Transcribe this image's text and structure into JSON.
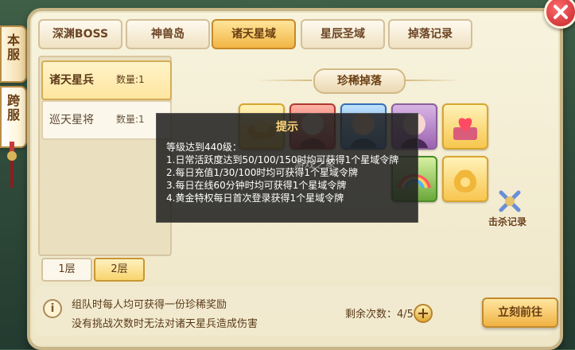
{
  "side_tabs": {
    "local": "本服",
    "cross": "跨服"
  },
  "top_tabs": [
    {
      "label": "深渊BOSS",
      "active": false
    },
    {
      "label": "神兽岛",
      "active": false
    },
    {
      "label": "诸天星域",
      "active": true
    },
    {
      "label": "星辰圣域",
      "active": false
    },
    {
      "label": "掉落记录",
      "active": false
    }
  ],
  "boss_list": [
    {
      "name": "诸天星兵",
      "quantity": "数量:1",
      "active": true
    },
    {
      "name": "巡天星将",
      "quantity": "数量:1",
      "active": false
    }
  ],
  "floors": [
    {
      "label": "1层",
      "active": false
    },
    {
      "label": "2层",
      "active": true
    }
  ],
  "rare_drops": {
    "title": "珍稀掉落"
  },
  "kill_record": {
    "label": "击杀记录"
  },
  "tooltip": {
    "title": "提示",
    "lines": [
      "等级达到440级：",
      "1.日常活跃度达到50/100/150时均可获得1个星域令牌",
      "2.每日充值1/30/100时均可获得1个星域令牌",
      "3.每日在线60分钟时均可获得1个星域令牌",
      "4.黄金特权每日首次登录获得1个星域令牌"
    ]
  },
  "watermark": "游戏之家",
  "bottom": {
    "info_lines": [
      "组队时每人均可获得一份珍稀奖励",
      "没有挑战次数时无法对诸天星兵造成伤害"
    ],
    "remain_label": "剩余次数：4/5",
    "go_button": "立刻前往"
  }
}
